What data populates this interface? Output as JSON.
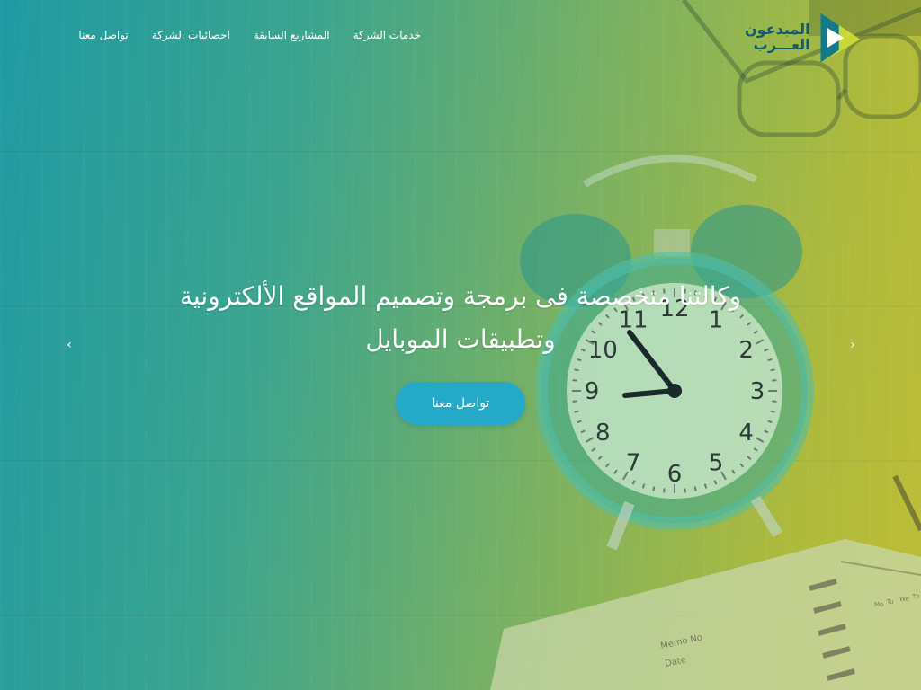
{
  "brand": {
    "line1": "المبدعون",
    "line2": "العـــرب"
  },
  "nav": {
    "items": [
      {
        "label": "خدمات الشركة"
      },
      {
        "label": "المشاريع السابقة"
      },
      {
        "label": "احصائيات الشركة"
      },
      {
        "label": "تواصل معنا"
      }
    ]
  },
  "hero": {
    "headline_line1": "وكالتنا متخصصة فى برمجة وتصميم المواقع الألكترونية",
    "headline_line2": "وتطبيقات الموبايل",
    "cta_label": "تواصل معنا",
    "prev_arrow": "‹",
    "next_arrow": "›"
  },
  "background": {
    "clock_numbers": [
      "12",
      "1",
      "2",
      "3",
      "4",
      "5",
      "6",
      "7",
      "8",
      "9",
      "10",
      "11"
    ],
    "notebook_text": [
      "Memo No",
      "Date"
    ],
    "calendar_days": [
      "Mo",
      "Tu",
      "We",
      "Th"
    ]
  },
  "colors": {
    "gradient_left": "#1f9aa3",
    "gradient_right": "#bfbe36",
    "cta": "#24a9c9",
    "logo_text": "#0f5c6e"
  },
  "icons": {
    "logo": "play-triangle-logo-icon",
    "prev": "chevron-left-icon",
    "next": "chevron-right-icon"
  }
}
